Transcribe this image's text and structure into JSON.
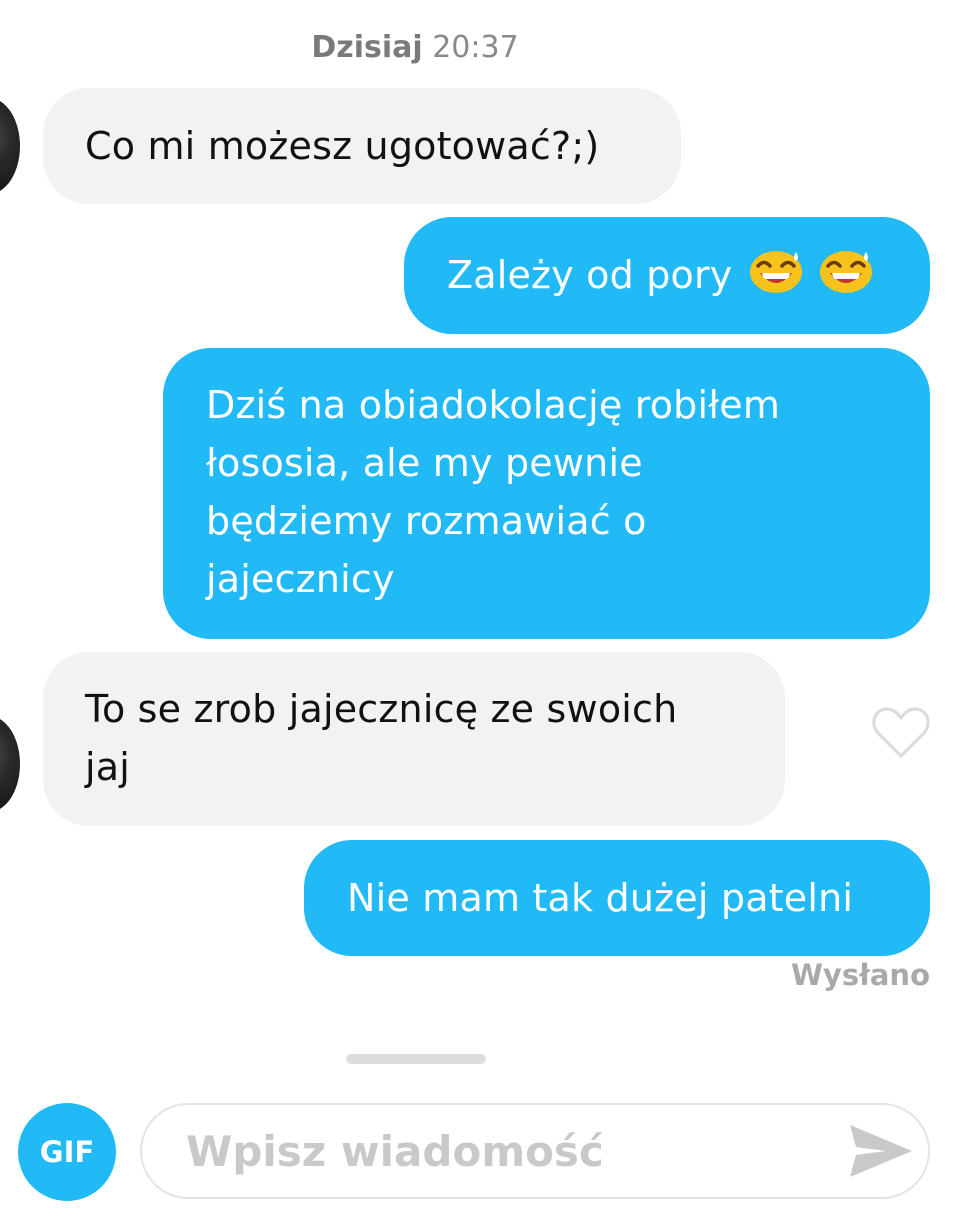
{
  "chat": {
    "date_label": "Dzisiaj",
    "time_label": "20:37",
    "messages": [
      {
        "direction": "incoming",
        "text": "Co mi możesz ugotować?;)"
      },
      {
        "direction": "outgoing",
        "text": "Zależy od pory",
        "emoji": [
          "grinning-sweat-emoji",
          "grinning-sweat-emoji"
        ]
      },
      {
        "direction": "outgoing",
        "lines": [
          "Dziś na obiadokolację robiłem",
          "łososia, ale my pewnie",
          "będziemy rozmawiać o",
          "jajecznicy"
        ]
      },
      {
        "direction": "incoming",
        "lines": [
          "To se zrob jajecznicę ze swoich",
          "jaj"
        ]
      },
      {
        "direction": "outgoing",
        "text": "Nie mam tak dużej patelni"
      }
    ],
    "status": "Wysłano"
  },
  "composer": {
    "gif_label": "GIF",
    "placeholder": "Wpisz wiadomość",
    "value": ""
  },
  "icons": {
    "like": "heart-outline-icon",
    "send": "send-arrow-icon"
  },
  "colors": {
    "accent": "#21b9f6",
    "incoming_bubble": "#f2f2f2",
    "muted_text": "#a9a9a9"
  }
}
